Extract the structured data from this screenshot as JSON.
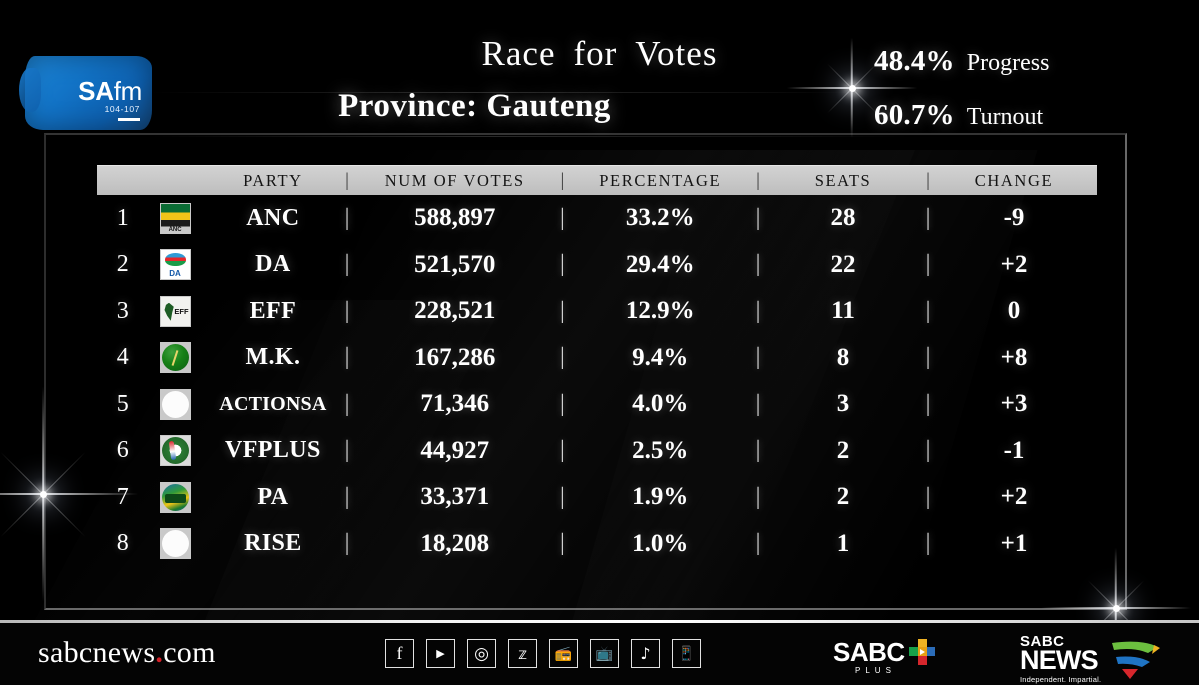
{
  "brand": {
    "station_logo": "SA",
    "station_logo_fm": "fm",
    "station_freq": "104-107"
  },
  "header": {
    "title_words": [
      "Race",
      "for",
      "Votes"
    ],
    "subtitle": "Province: Gauteng",
    "stats": [
      {
        "name": "progress",
        "value": "48.4%",
        "label": "Progress"
      },
      {
        "name": "turnout",
        "value": "60.7%",
        "label": "Turnout"
      }
    ]
  },
  "table": {
    "columns": [
      "PARTY",
      "NUM OF VOTES",
      "PERCENTAGE",
      "SEATS",
      "CHANGE"
    ],
    "separator": "|",
    "rows": [
      {
        "rank": "1",
        "logo": "anc",
        "party": "ANC",
        "votes": "588,897",
        "percentage": "33.2%",
        "seats": "28",
        "change": "-9"
      },
      {
        "rank": "2",
        "logo": "da",
        "party": "DA",
        "votes": "521,570",
        "percentage": "29.4%",
        "seats": "22",
        "change": "+2"
      },
      {
        "rank": "3",
        "logo": "eff",
        "party": "EFF",
        "votes": "228,521",
        "percentage": "12.9%",
        "seats": "11",
        "change": "0"
      },
      {
        "rank": "4",
        "logo": "mk",
        "party": "M.K.",
        "votes": "167,286",
        "percentage": "9.4%",
        "seats": "8",
        "change": "+8"
      },
      {
        "rank": "5",
        "logo": "blank",
        "party": "ACTIONSA",
        "votes": "71,346",
        "percentage": "4.0%",
        "seats": "3",
        "change": "+3"
      },
      {
        "rank": "6",
        "logo": "vf",
        "party": "VFPLUS",
        "votes": "44,927",
        "percentage": "2.5%",
        "seats": "2",
        "change": "-1"
      },
      {
        "rank": "7",
        "logo": "pa",
        "party": "PA",
        "votes": "33,371",
        "percentage": "1.9%",
        "seats": "2",
        "change": "+2"
      },
      {
        "rank": "8",
        "logo": "blank",
        "party": "RISE",
        "votes": "18,208",
        "percentage": "1.0%",
        "seats": "1",
        "change": "+1"
      }
    ]
  },
  "footer": {
    "url_prefix": "sabcnews",
    "url_dot": ".",
    "url_suffix": "com",
    "socials": [
      {
        "name": "facebook-icon",
        "glyph": "f"
      },
      {
        "name": "youtube-icon",
        "glyph": "▶"
      },
      {
        "name": "instagram-icon",
        "glyph": "◎"
      },
      {
        "name": "x-twitter-icon",
        "glyph": "𝕫"
      },
      {
        "name": "radio-icon",
        "glyph": "📻"
      },
      {
        "name": "tv-icon",
        "glyph": "📺"
      },
      {
        "name": "tiktok-icon",
        "glyph": "♪"
      },
      {
        "name": "mobile-icon",
        "glyph": "📱"
      }
    ],
    "sabc_plus": {
      "word": "SABC",
      "sub": "PLUS"
    },
    "sabc_news": {
      "line1": "SABC",
      "line2": "NEWS",
      "tagline": "Independent. Impartial."
    }
  },
  "colors": {
    "background": "#000000",
    "header_bar": "#c7c7c7",
    "header_text": "#141414",
    "body_text": "#ffffff",
    "accent_red": "#d31f26",
    "station_blue": "#1273c6"
  }
}
